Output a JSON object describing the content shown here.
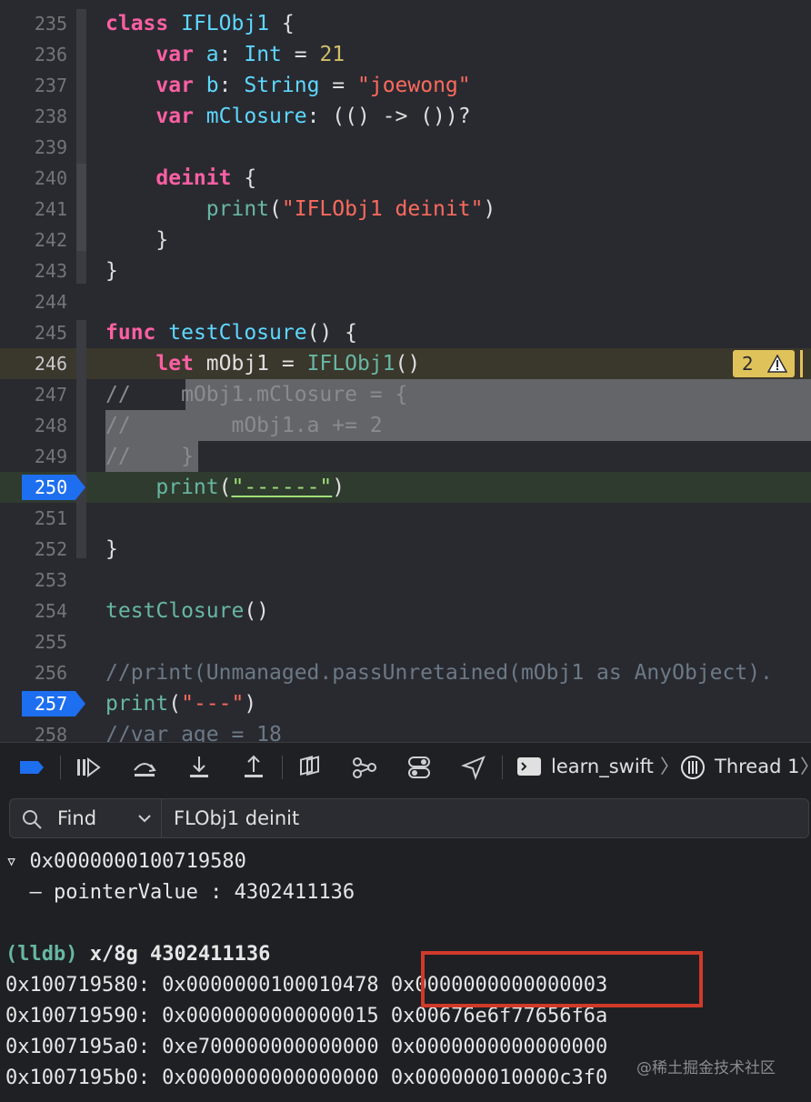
{
  "editor": {
    "lines": [
      {
        "n": "235",
        "tokens": [
          {
            "t": "class",
            "c": "kw"
          },
          {
            "t": " "
          },
          {
            "t": "IFLObj1",
            "c": "ty"
          },
          {
            "t": " {"
          }
        ]
      },
      {
        "n": "236",
        "tokens": [
          {
            "t": "    "
          },
          {
            "t": "var",
            "c": "kw"
          },
          {
            "t": " "
          },
          {
            "t": "a",
            "c": "ty"
          },
          {
            "t": ": "
          },
          {
            "t": "Int",
            "c": "ty"
          },
          {
            "t": " = "
          },
          {
            "t": "21",
            "c": "num"
          }
        ]
      },
      {
        "n": "237",
        "tokens": [
          {
            "t": "    "
          },
          {
            "t": "var",
            "c": "kw"
          },
          {
            "t": " "
          },
          {
            "t": "b",
            "c": "ty"
          },
          {
            "t": ": "
          },
          {
            "t": "String",
            "c": "ty"
          },
          {
            "t": " = "
          },
          {
            "t": "\"joewong\"",
            "c": "str"
          }
        ]
      },
      {
        "n": "238",
        "tokens": [
          {
            "t": "    "
          },
          {
            "t": "var",
            "c": "kw"
          },
          {
            "t": " "
          },
          {
            "t": "mClosure",
            "c": "ty"
          },
          {
            "t": ": (() -> ())?"
          }
        ]
      },
      {
        "n": "239",
        "tokens": []
      },
      {
        "n": "240",
        "tokens": [
          {
            "t": "    "
          },
          {
            "t": "deinit",
            "c": "kw"
          },
          {
            "t": " {"
          }
        ]
      },
      {
        "n": "241",
        "tokens": [
          {
            "t": "        "
          },
          {
            "t": "print",
            "c": "fn"
          },
          {
            "t": "("
          },
          {
            "t": "\"IFLObj1 deinit\"",
            "c": "str"
          },
          {
            "t": ")"
          }
        ]
      },
      {
        "n": "242",
        "tokens": [
          {
            "t": "    }"
          }
        ]
      },
      {
        "n": "243",
        "tokens": [
          {
            "t": "}"
          }
        ]
      },
      {
        "n": "244",
        "tokens": []
      },
      {
        "n": "245",
        "tokens": [
          {
            "t": "func",
            "c": "kw"
          },
          {
            "t": " "
          },
          {
            "t": "testClosure",
            "c": "ty"
          },
          {
            "t": "() {"
          }
        ]
      },
      {
        "n": "246",
        "tokens": [
          {
            "t": "    "
          },
          {
            "t": "let",
            "c": "kw"
          },
          {
            "t": " mObj1 = "
          },
          {
            "t": "IFLObj1",
            "c": "fn"
          },
          {
            "t": "()"
          }
        ]
      },
      {
        "n": "247",
        "tokens": [
          {
            "t": "//    mObj1.mClosure = {",
            "c": "cm"
          }
        ]
      },
      {
        "n": "248",
        "tokens": [
          {
            "t": "//        mObj1.a += 2",
            "c": "cm"
          }
        ]
      },
      {
        "n": "249",
        "tokens": [
          {
            "t": "//    }",
            "c": "cm"
          }
        ]
      },
      {
        "n": "250",
        "tokens": [
          {
            "t": "    "
          },
          {
            "t": "print",
            "c": "fn"
          },
          {
            "t": "("
          },
          {
            "t": "\"------\"",
            "c": "strg"
          },
          {
            "t": ")"
          }
        ]
      },
      {
        "n": "251",
        "tokens": []
      },
      {
        "n": "252",
        "tokens": [
          {
            "t": "}"
          }
        ]
      },
      {
        "n": "253",
        "tokens": []
      },
      {
        "n": "254",
        "tokens": [
          {
            "t": "testClosure",
            "c": "fn"
          },
          {
            "t": "()"
          }
        ]
      },
      {
        "n": "255",
        "tokens": []
      },
      {
        "n": "256",
        "tokens": [
          {
            "t": "//print(Unmanaged.passUnretained(mObj1 as AnyObject).",
            "c": "cm"
          }
        ]
      },
      {
        "n": "257",
        "tokens": [
          {
            "t": "print",
            "c": "fn"
          },
          {
            "t": "("
          },
          {
            "t": "\"---\"",
            "c": "str"
          },
          {
            "t": ")"
          }
        ]
      },
      {
        "n": "258",
        "tokens": [
          {
            "t": "//var age = 18",
            "c": "cm"
          }
        ]
      }
    ],
    "warning_count": "2"
  },
  "colors": {
    "background": "#292a30",
    "keyword": "#fc5fa3",
    "type": "#5dd8ff",
    "function": "#67b7a4",
    "string": "#fc6a5d",
    "number": "#d0bf69",
    "comment": "#6c7986",
    "breakpoint": "#1e6ff0",
    "warning": "#e0c25b",
    "highlight_box": "#d03a2a"
  },
  "toolbar": {
    "icons": [
      "breakpoint-toggle-icon",
      "continue-icon",
      "step-over-icon",
      "step-into-icon",
      "step-out-icon",
      "view-hierarchy-icon",
      "memory-graph-icon",
      "environment-overrides-icon",
      "location-icon",
      "terminal-icon",
      "thread-icon"
    ],
    "scheme": "learn_swift",
    "thread": "Thread 1"
  },
  "find": {
    "mode": "Find",
    "query": "FLObj1 deinit"
  },
  "console": {
    "lines": [
      "▿ 0x0000000100719580",
      "  – pointerValue : 4302411136",
      "",
      "(lldb) x/8g 4302411136",
      "0x100719580: 0x0000000100010478 0x0000000000000003",
      "0x100719590: 0x0000000000000015 0x00676e6f77656f6a",
      "0x1007195a0: 0xe700000000000000 0x0000000000000000",
      "0x1007195b0: 0x0000000000000000 0x000000010000c3f0"
    ]
  },
  "watermark": "@稀土掘金技术社区"
}
